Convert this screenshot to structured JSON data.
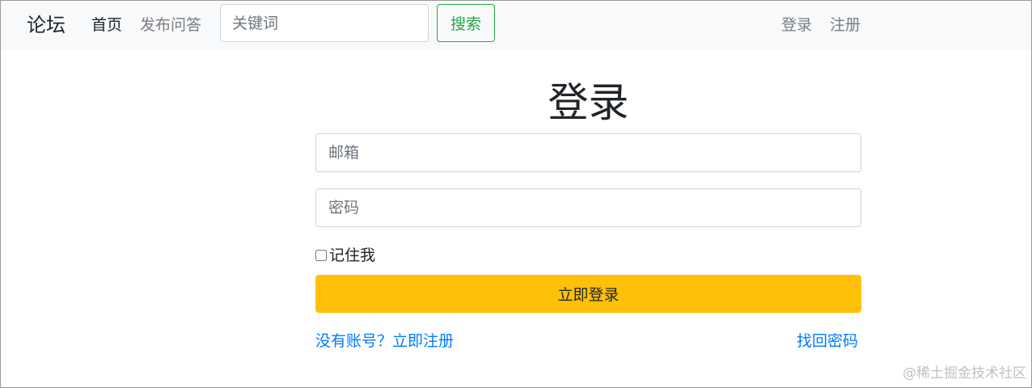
{
  "navbar": {
    "brand": "论坛",
    "links": [
      "首页",
      "发布问答"
    ],
    "search": {
      "placeholder": "关键词",
      "value": "",
      "button_label": "搜索"
    },
    "auth_links": [
      "登录",
      "注册"
    ]
  },
  "login_form": {
    "title": "登录",
    "email": {
      "placeholder": "邮箱",
      "value": ""
    },
    "password": {
      "placeholder": "密码",
      "value": ""
    },
    "remember_label": "记住我",
    "remember_checked": false,
    "submit_label": "立即登录",
    "register_link": "没有账号？立即注册",
    "forgot_link": "找回密码"
  },
  "watermark": "@稀土掘金技术社区",
  "colors": {
    "navbar_bg": "#f8f9fa",
    "search_button": "#28a745",
    "submit_button": "#ffc107",
    "link": "#007bff"
  }
}
